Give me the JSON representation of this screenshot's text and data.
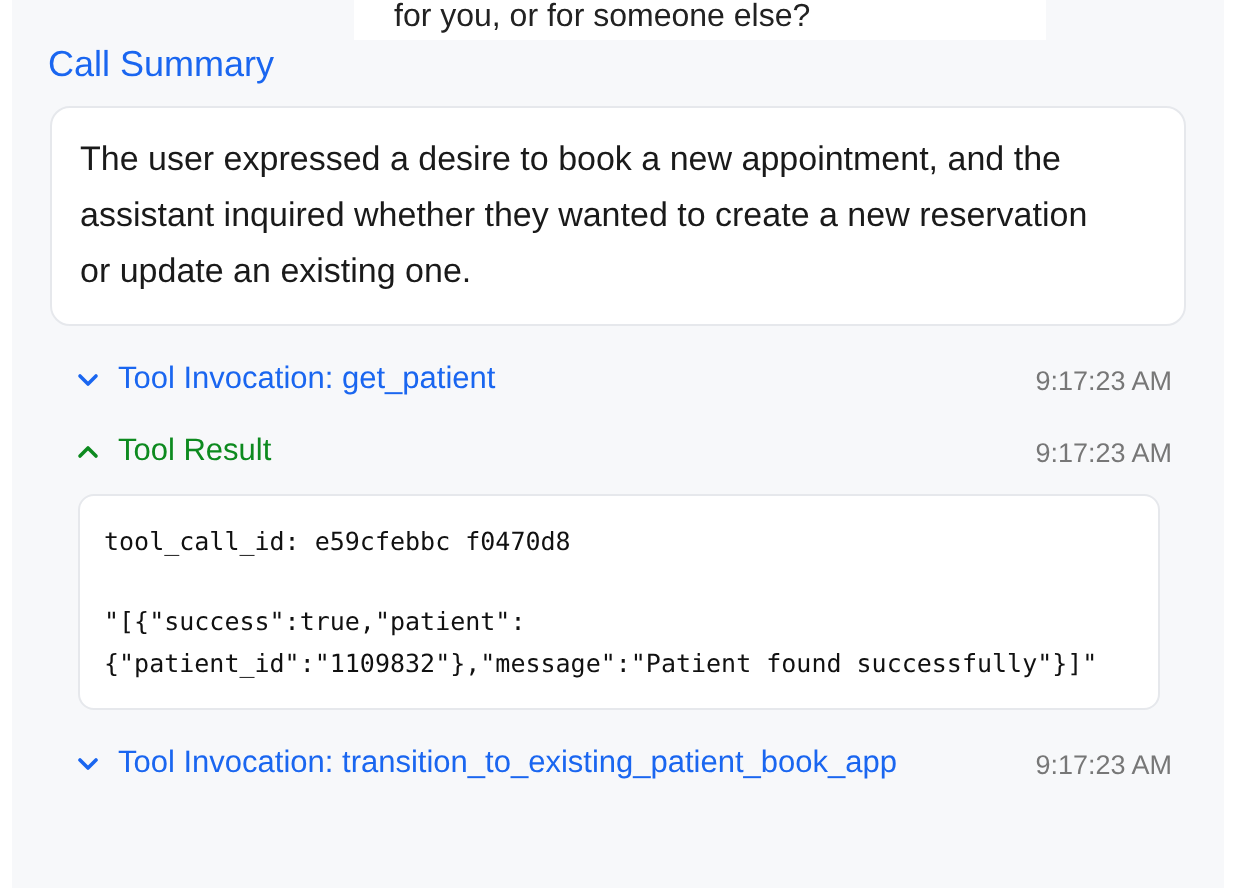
{
  "message_bubble": {
    "text": "for you, or for someone else?"
  },
  "call_summary": {
    "title": "Call Summary",
    "text": "The user expressed a desire to book a new appointment, and the assistant inquired whether they wanted to create a new reservation or update an existing one."
  },
  "events": [
    {
      "kind": "invocation",
      "title": "Tool Invocation: get_patient",
      "time": "9:17:23 AM",
      "expanded": false
    },
    {
      "kind": "result",
      "title": "Tool Result",
      "time": "9:17:23 AM",
      "expanded": true,
      "content": [
        "tool_call_id: e59cfebbc f0470d8",
        "\"[{\"success\":true,\"patient\":{\"patient_id\":\"1109832\"},\"message\":\"Patient found successfully\"}]\""
      ]
    },
    {
      "kind": "invocation",
      "title": "Tool Invocation: transition_to_existing_patient_book_app",
      "time": "9:17:23 AM",
      "expanded": false
    }
  ]
}
